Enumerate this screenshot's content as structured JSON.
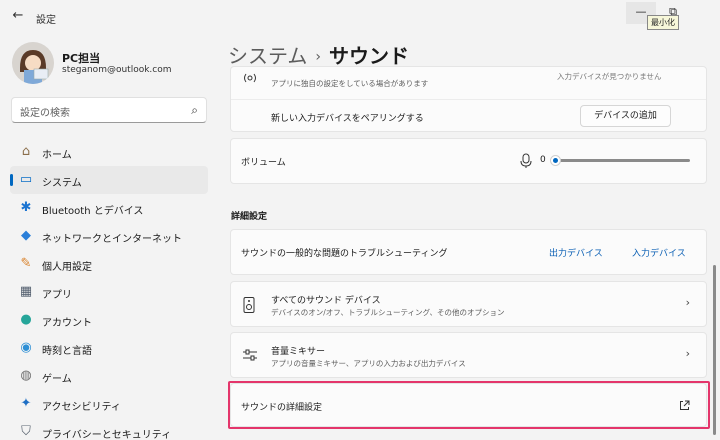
{
  "window": {
    "app_title": "設定",
    "back_icon": "←",
    "min_icon": "—",
    "max_icon": "⧉",
    "tooltip": "最小化"
  },
  "profile": {
    "name": "PC担当",
    "email": "steganom@outlook.com"
  },
  "search": {
    "placeholder": "設定の検索",
    "icon": "⌕"
  },
  "nav": {
    "items": [
      {
        "label": "ホーム",
        "icon": "home-icon",
        "glyph": "⌂",
        "color": "#8a6d4a",
        "active": false
      },
      {
        "label": "システム",
        "icon": "system-icon",
        "glyph": "▭",
        "color": "#0a6ec7",
        "active": true
      },
      {
        "label": "Bluetooth とデバイス",
        "icon": "bluetooth-icon",
        "glyph": "✱",
        "color": "#1b74d1",
        "active": false
      },
      {
        "label": "ネットワークとインターネット",
        "icon": "wifi-icon",
        "glyph": "◆",
        "color": "#2a7fd9",
        "active": false
      },
      {
        "label": "個人用設定",
        "icon": "brush-icon",
        "glyph": "✎",
        "color": "#d9822b",
        "active": false
      },
      {
        "label": "アプリ",
        "icon": "apps-icon",
        "glyph": "▦",
        "color": "#4f5b6b",
        "active": false
      },
      {
        "label": "アカウント",
        "icon": "account-icon",
        "glyph": "●",
        "color": "#26a69a",
        "active": false
      },
      {
        "label": "時刻と言語",
        "icon": "globe-clock-icon",
        "glyph": "◉",
        "color": "#2d8fd5",
        "active": false
      },
      {
        "label": "ゲーム",
        "icon": "gamepad-icon",
        "glyph": "◍",
        "color": "#6d6d6d",
        "active": false
      },
      {
        "label": "アクセシビリティ",
        "icon": "accessibility-icon",
        "glyph": "✦",
        "color": "#1f6fc4",
        "active": false
      },
      {
        "label": "プライバシーとセキュリティ",
        "icon": "shield-icon",
        "glyph": "⛉",
        "color": "#5a6470",
        "active": false
      }
    ]
  },
  "breadcrumb": {
    "parent": "システム",
    "separator": "›",
    "current": "サウンド"
  },
  "input_card": {
    "truncated_sub": "アプリに独自の設定をしている場合があります",
    "truncated_right": "入力デバイスが見つかりません",
    "pair_label": "新しい入力デバイスをペアリングする",
    "add_button": "デバイスの追加"
  },
  "volume": {
    "label": "ボリューム",
    "value": "0",
    "level": 0
  },
  "advanced": {
    "section_title": "詳細設定",
    "troubleshoot_label": "サウンドの一般的な問題のトラブルシューティング",
    "output_link": "出力デバイス",
    "input_link": "入力デバイス",
    "all_devices_title": "すべてのサウンド デバイス",
    "all_devices_sub": "デバイスのオン/オフ、トラブルシューティング、その他のオプション",
    "mixer_title": "音量ミキサー",
    "mixer_sub": "アプリの音量ミキサー、アプリの入力および出力デバイス",
    "more_settings": "サウンドの詳細設定"
  },
  "colors": {
    "accent": "#0067c0",
    "highlight": "#e4356b"
  }
}
